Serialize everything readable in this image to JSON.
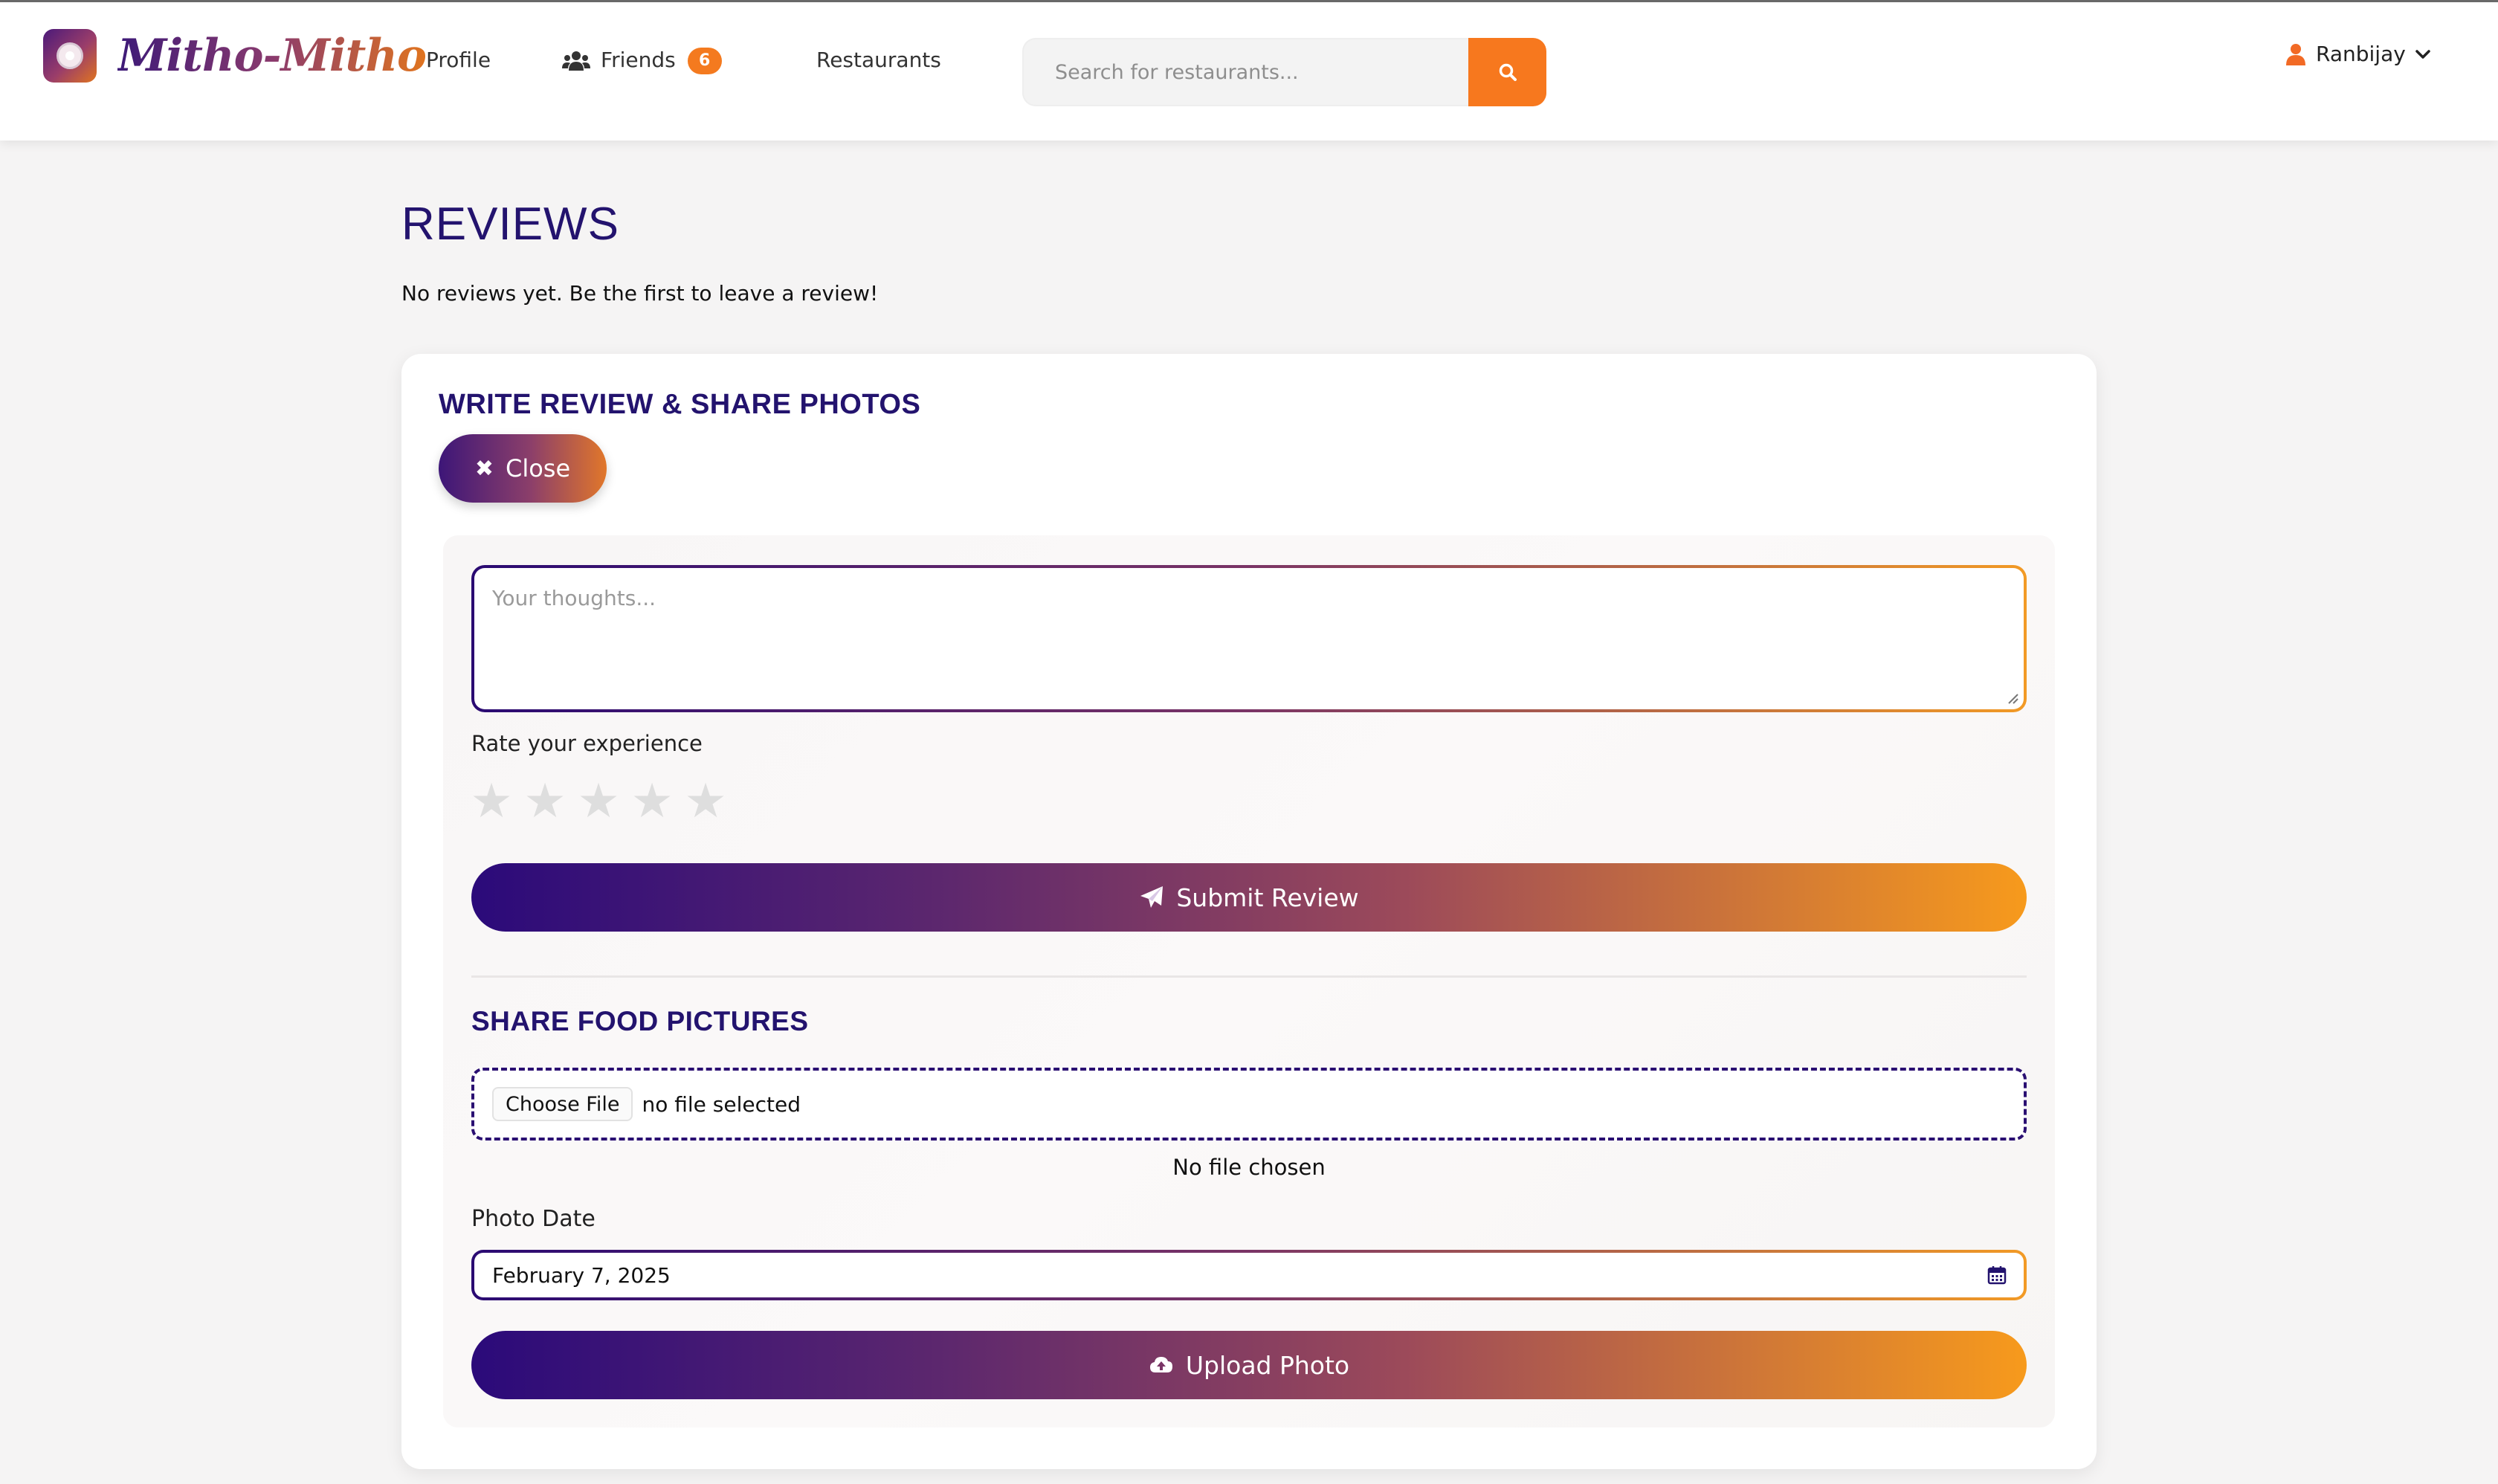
{
  "brand": {
    "name": "Mitho-Mitho"
  },
  "nav": {
    "profile": "Profile",
    "friends": "Friends",
    "friends_count": "6",
    "restaurants": "Restaurants"
  },
  "search": {
    "placeholder": "Search for restaurants..."
  },
  "user": {
    "name": "Ranbijay"
  },
  "reviews": {
    "title": "REVIEWS",
    "empty_message": "No reviews yet. Be the first to leave a review!"
  },
  "write_review": {
    "title": "WRITE REVIEW & SHARE PHOTOS",
    "close_label": "Close",
    "thoughts_placeholder": "Your thoughts...",
    "rate_label": "Rate your experience",
    "stars": [
      "★",
      "★",
      "★",
      "★",
      "★"
    ],
    "rating": 0,
    "submit_label": "Submit Review"
  },
  "share_photos": {
    "title": "SHARE FOOD PICTURES",
    "choose_file_label": "Choose File",
    "file_status": "no file selected",
    "no_file_chosen": "No file chosen",
    "photo_date_label": "Photo Date",
    "photo_date_value": "February 7, 2025",
    "upload_label": "Upload Photo"
  },
  "colors": {
    "brand_purple": "#23136e",
    "brand_orange": "#f7781e",
    "gradient_start": "#2b0a7a",
    "gradient_end": "#f79a1c"
  },
  "icons": {
    "friends": "users-icon",
    "search": "search-icon",
    "user": "user-icon",
    "chevron": "chevron-down-icon",
    "close": "close-icon",
    "submit": "paper-plane-icon",
    "upload": "cloud-upload-icon",
    "calendar": "calendar-icon"
  }
}
